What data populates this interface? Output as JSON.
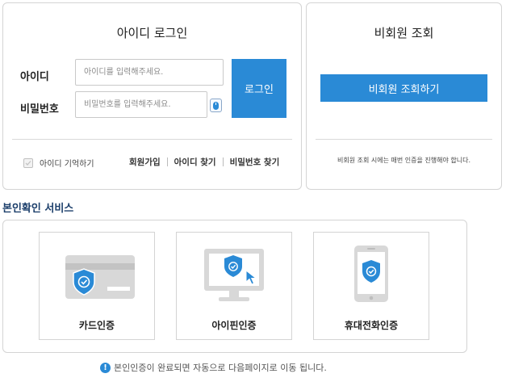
{
  "login": {
    "title": "아이디 로그인",
    "id_label": "아이디",
    "id_placeholder": "아이디를 입력해주세요.",
    "pw_label": "비밀번호",
    "pw_placeholder": "비밀번호를 입력해주세요.",
    "login_button": "로그인",
    "remember_label": "아이디 기억하기",
    "remember_checked": false,
    "links": [
      "회원가입",
      "아이디 찾기",
      "비밀번호 찾기"
    ]
  },
  "guest": {
    "title": "비회원 조회",
    "button": "비회원 조회하기",
    "note": "비회원 조회 시에는 매번 인증을 진행해야 합니다."
  },
  "verification": {
    "section_title": "본인확인 서비스",
    "methods": [
      {
        "label": "카드인증",
        "icon": "credit-card-shield-icon"
      },
      {
        "label": "아이핀인증",
        "icon": "monitor-shield-icon"
      },
      {
        "label": "휴대전화인증",
        "icon": "smartphone-shield-icon"
      }
    ],
    "notice_icon": "!",
    "notice": "본인인증이 완료되면 자동으로 다음페이지로 이동 됩니다."
  },
  "colors": {
    "accent": "#2a8ad6",
    "section_title": "#1c3f6b",
    "icon_gray": "#d8d8d8"
  }
}
